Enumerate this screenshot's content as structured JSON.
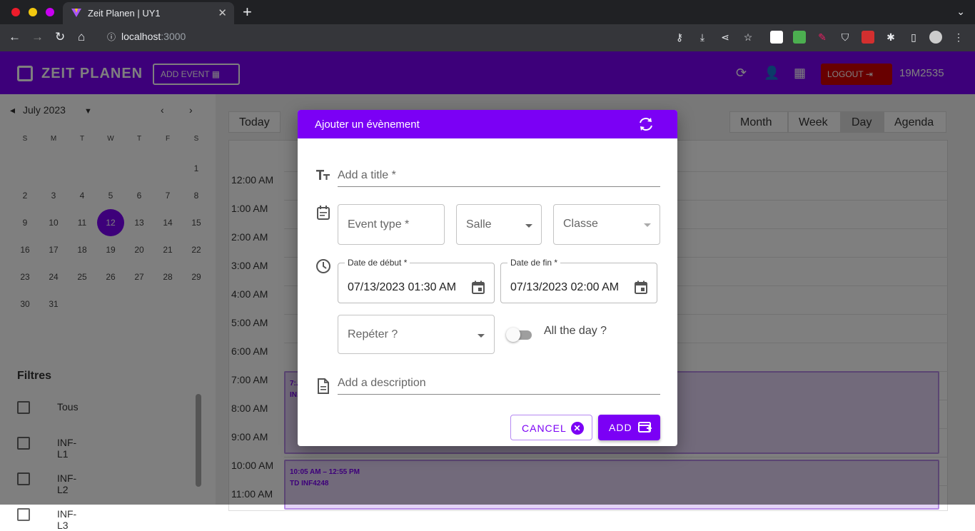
{
  "browser": {
    "tab_title": "Zeit Planen | UY1",
    "url_host": "localhost",
    "url_port": ":3000"
  },
  "appbar": {
    "brand": "ZEIT PLANEN",
    "add_event": "ADD EVENT",
    "logout": "LOGOUT",
    "user": "19M2535"
  },
  "calendar": {
    "month": "July 2023",
    "weekdays": [
      "S",
      "M",
      "T",
      "W",
      "T",
      "F",
      "S"
    ],
    "weeks": [
      [
        "",
        "",
        "",
        "",
        "",
        "",
        "1"
      ],
      [
        "2",
        "3",
        "4",
        "5",
        "6",
        "7",
        "8"
      ],
      [
        "9",
        "10",
        "11",
        "12",
        "13",
        "14",
        "15"
      ],
      [
        "16",
        "17",
        "18",
        "19",
        "20",
        "21",
        "22"
      ],
      [
        "23",
        "24",
        "25",
        "26",
        "27",
        "28",
        "29"
      ],
      [
        "30",
        "31",
        "",
        "",
        "",
        "",
        ""
      ]
    ],
    "selected_day": "12"
  },
  "filters": {
    "title": "Filtres",
    "items": [
      "Tous",
      "INF-L1",
      "INF-L2",
      "INF-L3"
    ]
  },
  "toolbar": {
    "today": "Today",
    "views": [
      "Month",
      "Week",
      "Day",
      "Agenda"
    ],
    "active_view": "Day"
  },
  "day_view": {
    "hours": [
      "12:00 AM",
      "1:00 AM",
      "2:00 AM",
      "3:00 AM",
      "4:00 AM",
      "5:00 AM",
      "6:00 AM",
      "7:00 AM",
      "8:00 AM",
      "9:00 AM",
      "10:00 AM",
      "11:00 AM"
    ],
    "events": [
      {
        "time": "7:...",
        "label": "IN..."
      },
      {
        "time": "10:05 AM – 12:55 PM",
        "label": "TD INF4248"
      }
    ]
  },
  "modal": {
    "title": "Ajouter un évènement",
    "title_placeholder": "Add a title *",
    "event_type": "Event type *",
    "salle": "Salle",
    "classe": "Classe",
    "start_label": "Date de début *",
    "start_value": "07/13/2023 01:30 AM",
    "end_label": "Date de fin *",
    "end_value": "07/13/2023 02:00 AM",
    "repeat": "Repéter ?",
    "all_day": "All the day ?",
    "description_placeholder": "Add a description",
    "cancel": "CANCEL",
    "add": "ADD"
  },
  "colors": {
    "primary": "#7b00f5",
    "logout": "#d00000"
  }
}
